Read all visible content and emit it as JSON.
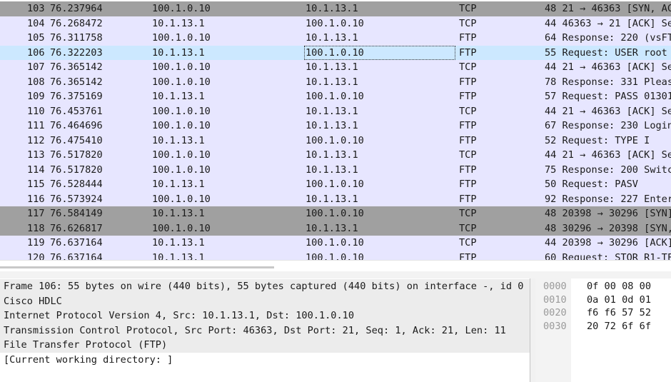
{
  "packets": [
    {
      "no": "103",
      "time": "76.237964",
      "source": "100.1.0.10",
      "destination": "10.1.13.1",
      "protocol": "TCP",
      "info": "48 21 → 46363 [SYN, AC"
    },
    {
      "no": "104",
      "time": "76.268472",
      "source": "10.1.13.1",
      "destination": "100.1.0.10",
      "protocol": "TCP",
      "info": "44 46363 → 21 [ACK] Se"
    },
    {
      "no": "105",
      "time": "76.311758",
      "source": "100.1.0.10",
      "destination": "10.1.13.1",
      "protocol": "FTP",
      "info": "64 Response: 220 (vsFT"
    },
    {
      "no": "106",
      "time": "76.322203",
      "source": "10.1.13.1",
      "destination": "100.1.0.10",
      "protocol": "FTP",
      "info": "55 Request: USER root"
    },
    {
      "no": "107",
      "time": "76.365142",
      "source": "100.1.0.10",
      "destination": "10.1.13.1",
      "protocol": "TCP",
      "info": "44 21 → 46363 [ACK] Se"
    },
    {
      "no": "108",
      "time": "76.365142",
      "source": "100.1.0.10",
      "destination": "10.1.13.1",
      "protocol": "FTP",
      "info": "78 Response: 331 Pleas"
    },
    {
      "no": "109",
      "time": "76.375169",
      "source": "10.1.13.1",
      "destination": "100.1.0.10",
      "protocol": "FTP",
      "info": "57 Request: PASS 01301"
    },
    {
      "no": "110",
      "time": "76.453761",
      "source": "100.1.0.10",
      "destination": "10.1.13.1",
      "protocol": "TCP",
      "info": "44 21 → 46363 [ACK] Se"
    },
    {
      "no": "111",
      "time": "76.464696",
      "source": "100.1.0.10",
      "destination": "10.1.13.1",
      "protocol": "FTP",
      "info": "67 Response: 230 Login"
    },
    {
      "no": "112",
      "time": "76.475410",
      "source": "10.1.13.1",
      "destination": "100.1.0.10",
      "protocol": "FTP",
      "info": "52 Request: TYPE I"
    },
    {
      "no": "113",
      "time": "76.517820",
      "source": "100.1.0.10",
      "destination": "10.1.13.1",
      "protocol": "TCP",
      "info": "44 21 → 46363 [ACK] Se"
    },
    {
      "no": "114",
      "time": "76.517820",
      "source": "100.1.0.10",
      "destination": "10.1.13.1",
      "protocol": "FTP",
      "info": "75 Response: 200 Switc"
    },
    {
      "no": "115",
      "time": "76.528444",
      "source": "10.1.13.1",
      "destination": "100.1.0.10",
      "protocol": "FTP",
      "info": "50 Request: PASV"
    },
    {
      "no": "116",
      "time": "76.573924",
      "source": "100.1.0.10",
      "destination": "10.1.13.1",
      "protocol": "FTP",
      "info": "92 Response: 227 Enter"
    },
    {
      "no": "117",
      "time": "76.584149",
      "source": "10.1.13.1",
      "destination": "100.1.0.10",
      "protocol": "TCP",
      "info": "48 20398 → 30296 [SYN]"
    },
    {
      "no": "118",
      "time": "76.626817",
      "source": "100.1.0.10",
      "destination": "10.1.13.1",
      "protocol": "TCP",
      "info": "48 30296 → 20398 [SYN,"
    },
    {
      "no": "119",
      "time": "76.637164",
      "source": "10.1.13.1",
      "destination": "100.1.0.10",
      "protocol": "TCP",
      "info": "44 20398 → 30296 [ACK]"
    },
    {
      "no": "120",
      "time": "76.637164",
      "source": "10.1.13.1",
      "destination": "100.1.0.10",
      "protocol": "FTP",
      "info": "60 Request: STOR R1-TF"
    }
  ],
  "details": [
    "Frame 106: 55 bytes on wire (440 bits), 55 bytes captured (440 bits) on interface -, id 0",
    "Cisco HDLC",
    "Internet Protocol Version 4, Src: 10.1.13.1, Dst: 100.1.0.10",
    "Transmission Control Protocol, Src Port: 46363, Dst Port: 21, Seq: 1, Ack: 21, Len: 11",
    "File Transfer Protocol (FTP)",
    "[Current working directory: ]"
  ],
  "bytes": [
    {
      "offset": "0000",
      "hex": "0f 00 08 00"
    },
    {
      "offset": "0010",
      "hex": "0a 01 0d 01"
    },
    {
      "offset": "0020",
      "hex": "f6 f6 57 52"
    },
    {
      "offset": "0030",
      "hex": "20 72 6f 6f"
    }
  ],
  "colors": {
    "row_default": "#e7e6ff",
    "row_tcp_handshake": "#a0a0a0",
    "row_selected": "#cce8ff"
  }
}
